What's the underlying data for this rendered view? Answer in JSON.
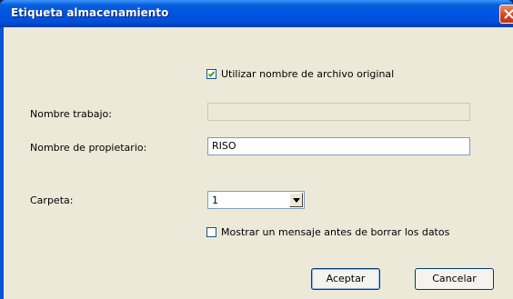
{
  "window": {
    "title": "Etiqueta almacenamiento",
    "close_icon": "close-icon"
  },
  "form": {
    "use_original_filename": {
      "label": "Utilizar nombre de archivo original",
      "checked": true
    },
    "job_name": {
      "label": "Nombre trabajo:",
      "value": "",
      "disabled": true
    },
    "owner_name": {
      "label": "Nombre de propietario:",
      "value": "RISO"
    },
    "folder": {
      "label": "Carpeta:",
      "value": "1"
    },
    "confirm_delete": {
      "label": "Mostrar un mensaje antes de borrar los datos",
      "checked": false
    }
  },
  "buttons": {
    "ok": "Aceptar",
    "cancel": "Cancelar"
  },
  "colors": {
    "titlebar": "#0054e3",
    "dialog_bg": "#ece9d8",
    "close_button": "#d3421b"
  }
}
